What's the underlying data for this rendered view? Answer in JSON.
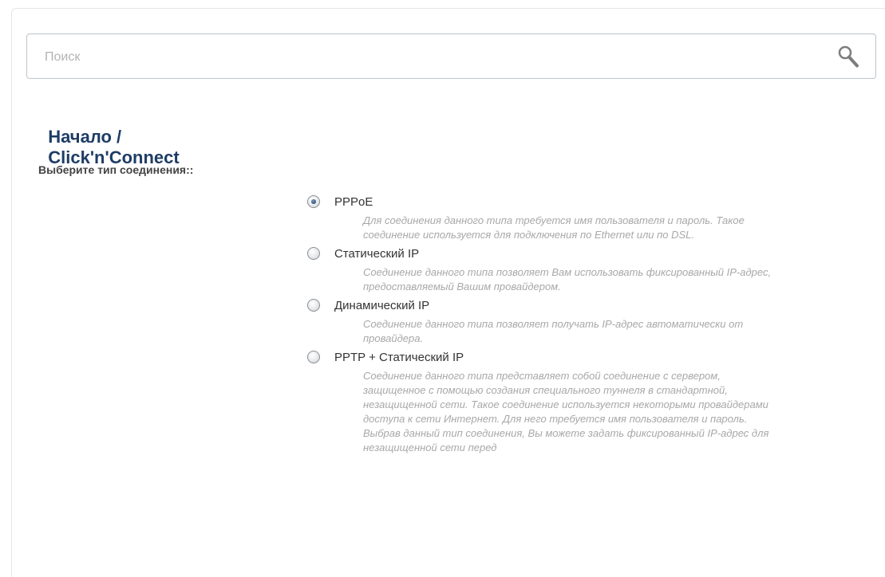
{
  "search": {
    "placeholder": "Поиск",
    "icon": "search-icon"
  },
  "breadcrumb": {
    "home": "Начало /",
    "current": "Click'n'Connect",
    "color": "#1e3d66"
  },
  "section": {
    "label": "Выберите тип соединения::"
  },
  "connection_types": [
    {
      "label": "PPPoE",
      "selected": true,
      "description": "Для соединения данного типа требуется имя пользователя и пароль. Такое соединение используется для подключения по Ethernet или по DSL."
    },
    {
      "label": "Статический IP",
      "selected": false,
      "description": "Соединение данного типа позволяет Вам использовать фиксированный IP-адрес, предоставляемый Вашим провайдером."
    },
    {
      "label": "Динамический IP",
      "selected": false,
      "description": "Соединение данного типа позволяет получать IP-адрес автоматически от провайдера."
    },
    {
      "label": "PPTP + Статический IP",
      "selected": false,
      "description": "Соединение данного типа представляет собой соединение с сервером, защищенное с помощью создания специального туннеля в стандартной, незащищенной сети. Такое соединение используется некоторыми провайдерами доступа к сети Интернет. Для него требуется имя пользователя и пароль. Выбрав данный тип соединения, Вы можете задать фиксированный IP-адрес для незащищенной сети перед"
    }
  ]
}
